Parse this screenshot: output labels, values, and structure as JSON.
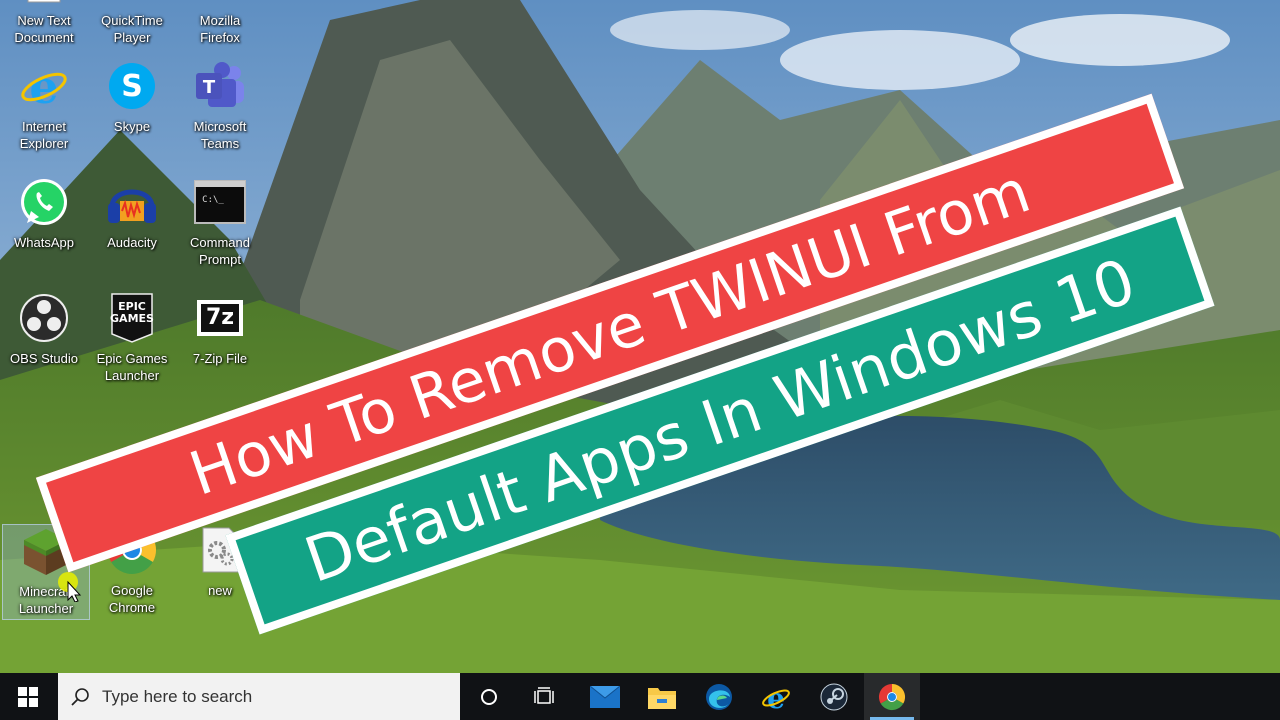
{
  "desktop": {
    "icons": [
      {
        "label": "New Text\nDocument",
        "icon": "text-document-icon"
      },
      {
        "label": "QuickTime\nPlayer",
        "icon": "quicktime-icon"
      },
      {
        "label": "Mozilla\nFirefox",
        "icon": "firefox-icon"
      },
      {
        "label": "Internet\nExplorer",
        "icon": "internet-explorer-icon"
      },
      {
        "label": "Skype",
        "icon": "skype-icon"
      },
      {
        "label": "Microsoft\nTeams",
        "icon": "teams-icon"
      },
      {
        "label": "WhatsApp",
        "icon": "whatsapp-icon"
      },
      {
        "label": "Audacity",
        "icon": "audacity-icon"
      },
      {
        "label": "Command\nPrompt",
        "icon": "command-prompt-icon"
      },
      {
        "label": "OBS Studio",
        "icon": "obs-icon"
      },
      {
        "label": "Epic Games\nLauncher",
        "icon": "epic-games-icon"
      },
      {
        "label": "7-Zip File",
        "icon": "7zip-icon"
      },
      {
        "label": "Minecraft\nLauncher",
        "icon": "minecraft-icon"
      },
      {
        "label": "Google\nChrome",
        "icon": "chrome-icon"
      },
      {
        "label": "new",
        "icon": "settings-file-icon"
      }
    ],
    "epic_logo_text": "EPIC\nGAMES",
    "sevenzip_logo_text": "7z",
    "cmd_prompt_text": "C:\\_"
  },
  "overlay": {
    "title_line1": "How To Remove TWINUI From",
    "title_line2": "Default Apps In Windows 10",
    "line1_color": "#ef4444",
    "line2_color": "#13a386"
  },
  "taskbar": {
    "search_placeholder": "Type here to search",
    "pinned": [
      "cortana-icon",
      "task-view-icon",
      "mail-icon",
      "file-explorer-icon",
      "edge-icon",
      "internet-explorer-icon",
      "steam-icon",
      "chrome-icon"
    ],
    "active_app": "chrome-icon"
  }
}
